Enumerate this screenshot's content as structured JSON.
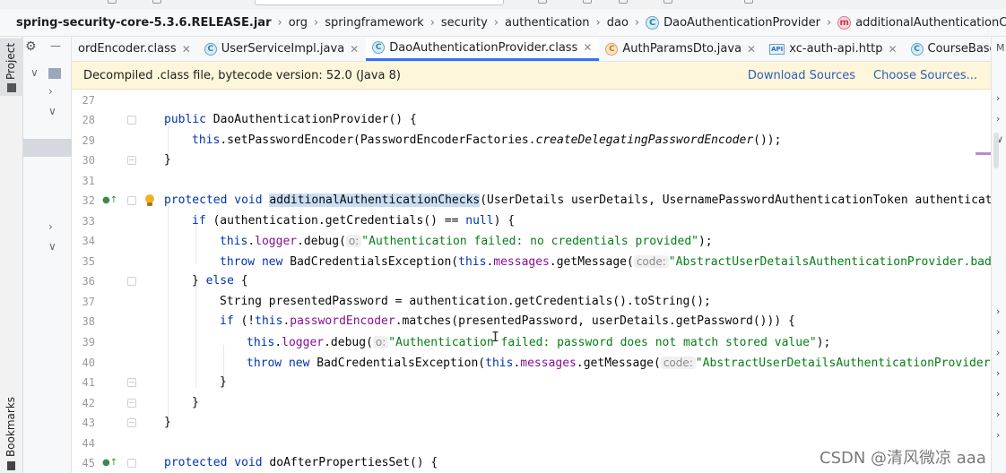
{
  "breadcrumb": {
    "items": [
      {
        "label": "spring-security-core-5.3.6.RELEASE.jar",
        "kind": "jar"
      },
      {
        "label": "org",
        "kind": "package"
      },
      {
        "label": "springframework",
        "kind": "package"
      },
      {
        "label": "security",
        "kind": "package"
      },
      {
        "label": "authentication",
        "kind": "package"
      },
      {
        "label": "dao",
        "kind": "package"
      },
      {
        "label": "DaoAuthenticationProvider",
        "kind": "class",
        "icon_letter": "C"
      },
      {
        "label": "additionalAuthenticationChecks",
        "kind": "method",
        "icon_letter": "m"
      }
    ]
  },
  "leftbar": {
    "project_label": "Project",
    "bookmarks_label": "Bookmarks"
  },
  "tabs": [
    {
      "label": "ordEncoder.class",
      "icon": "class-icon",
      "active": false,
      "closable": false
    },
    {
      "label": "UserServiceImpl.java",
      "icon": "class-icon",
      "icon_letter": "C",
      "active": false,
      "closable": true
    },
    {
      "label": "DaoAuthenticationProvider.class",
      "icon": "class-icon",
      "icon_letter": "C",
      "active": true,
      "closable": true
    },
    {
      "label": "AuthParamsDto.java",
      "icon": "class-icon",
      "icon_letter": "C",
      "active": false,
      "closable": true
    },
    {
      "label": "xc-auth-api.http",
      "icon": "api-icon",
      "icon_text": "API",
      "active": false,
      "closable": true
    },
    {
      "label": "CourseBaseInfoCont",
      "icon": "class-icon",
      "icon_letter": "C",
      "active": false,
      "closable": false
    }
  ],
  "banner": {
    "message": "Decompiled .class file, bytecode version: 52.0 (Java 8)",
    "download_sources": "Download Sources",
    "choose_sources": "Choose Sources..."
  },
  "editor": {
    "line_numbers": [
      "27",
      "28",
      "29",
      "30",
      "31",
      "32",
      "33",
      "34",
      "35",
      "36",
      "37",
      "38",
      "39",
      "40",
      "41",
      "42",
      "43",
      "44",
      "45"
    ],
    "line_28": {
      "kw": "public",
      "rest": " DaoAuthenticationProvider() {"
    },
    "line_29": {
      "kw": "this",
      "a": ".setPasswordEncoder(PasswordEncoderFactories.",
      "italic": "createDelegatingPasswordEncoder",
      "b": "());"
    },
    "line_30": "}",
    "line_32": {
      "kw1": "protected",
      "kw2": "void",
      "method": "additionalAuthenticationChecks",
      "rest": "(UserDetails userDetails, UsernamePasswordAuthenticationToken authenticatio"
    },
    "line_33": {
      "kw": "if",
      "a": " (authentication.getCredentials() == ",
      "kw2": "null",
      "b": ") {"
    },
    "line_34": {
      "kw": "this",
      "field": "logger",
      "a": ".debug(",
      "hint": "o:",
      "str": "\"Authentication failed: no credentials provided\"",
      "b": ");"
    },
    "line_35": {
      "kw1": "throw",
      "kw2": "new",
      "a": " BadCredentialsException(",
      "kw3": "this",
      "field": "messages",
      "b": ".getMessage(",
      "hint": "code:",
      "str": "\"AbstractUserDetailsAuthenticationProvider.badCr"
    },
    "line_36": {
      "a": "} ",
      "kw": "else",
      "b": " {"
    },
    "line_37": {
      "a": "String presentedPassword = authentication.getCredentials().toString();"
    },
    "line_38": {
      "kw": "if",
      "a": " (!",
      "kw2": "this",
      "field": "passwordEncoder",
      "b": ".matches(presentedPassword, userDetails.getPassword())) {"
    },
    "line_39": {
      "kw": "this",
      "field": "logger",
      "a": ".debug(",
      "hint": "o:",
      "str": "\"Authentication failed: password does not match stored value\"",
      "b": ");"
    },
    "line_40": {
      "kw1": "throw",
      "kw2": "new",
      "a": " BadCredentialsException(",
      "kw3": "this",
      "field": "messages",
      "b": ".getMessage(",
      "hint": "code:",
      "str": "\"AbstractUserDetailsAuthenticationProvider.b"
    },
    "line_41": "}",
    "line_42": "}",
    "line_43": "}",
    "line_45": {
      "kw1": "protected",
      "kw2": "void",
      "rest": " doAfterPropertiesSet() {"
    }
  },
  "watermark": "CSDN @清风微凉 aaa",
  "colors": {
    "keyword": "#0033b3",
    "string": "#067d17",
    "field": "#871094",
    "selection": "#c9def5",
    "banner_bg": "#fdf6da",
    "active_tab_underline": "#3574f0"
  }
}
